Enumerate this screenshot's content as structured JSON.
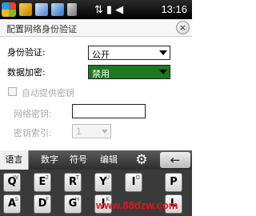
{
  "status": {
    "time": "13:16",
    "icons": [
      "windows-logo",
      "task-icon",
      "task-icon",
      "task-icon",
      "task-icon",
      "wifi-icon",
      "signal-icon",
      "volume-icon"
    ]
  },
  "window": {
    "title": "配置网络身份验证",
    "close_label": "×"
  },
  "form": {
    "auth_label": "身份验证:",
    "auth_value": "公开",
    "enc_label": "数据加密:",
    "enc_value": "禁用",
    "auto_key_label": "自动提供密钥",
    "net_key_label": "网络密钥:",
    "key_index_label": "密钥索引:",
    "key_index_value": "1"
  },
  "keyboard": {
    "tabs": [
      "语言",
      "数字",
      "符号",
      "编辑"
    ],
    "active_tab": "语言",
    "backspace_icon": "←",
    "gear_icon": "⚙",
    "row1": [
      {
        "main": "Q",
        "sub": "W"
      },
      {
        "main": "E",
        "sub": "2"
      },
      {
        "main": "R",
        "sub": "T"
      },
      {
        "main": "Y",
        "sub": "U"
      },
      {
        "main": "I",
        "sub": "O"
      },
      {
        "main": "P",
        "sub": ""
      }
    ],
    "row2": [
      {
        "main": "A",
        "sub": "S"
      },
      {
        "main": "D",
        "sub": "F"
      },
      {
        "main": "G",
        "sub": "H"
      },
      {
        "main": "J",
        "sub": "K"
      },
      {
        "main": "L",
        "sub": ""
      }
    ]
  },
  "watermark": "www.88dzw.com",
  "colors": {
    "selected_dropdown": "#1c7a1c",
    "status_bar": "#000000"
  }
}
